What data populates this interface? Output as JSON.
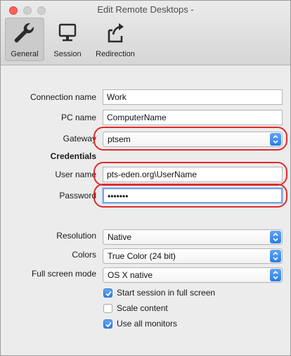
{
  "window": {
    "title": "Edit Remote Desktops -"
  },
  "toolbar": {
    "general_label": "General",
    "session_label": "Session",
    "redirection_label": "Redirection"
  },
  "form": {
    "connection_name": {
      "label": "Connection name",
      "value": "Work"
    },
    "pc_name": {
      "label": "PC name",
      "value": "ComputerName"
    },
    "gateway": {
      "label": "Gateway",
      "value": "ptsem"
    },
    "credentials_heading": "Credentials",
    "user_name": {
      "label": "User name",
      "value": "pts-eden.org\\UserName"
    },
    "password": {
      "label": "Password",
      "value": "•••••••"
    },
    "resolution": {
      "label": "Resolution",
      "value": "Native"
    },
    "colors": {
      "label": "Colors",
      "value": "True Color (24 bit)"
    },
    "full_screen_mode": {
      "label": "Full screen mode",
      "value": "OS X native"
    },
    "checkboxes": [
      {
        "label": "Start session in full screen",
        "checked": true
      },
      {
        "label": "Scale content",
        "checked": false
      },
      {
        "label": "Use all monitors",
        "checked": true
      }
    ]
  },
  "colors": {
    "accent": "#2b7de9",
    "highlight": "#e12a2a",
    "close_button": "#fc605c"
  },
  "icons": {
    "general": "wrench-icon",
    "session": "monitor-icon",
    "redirection": "export-icon",
    "dropdown": "updown-arrows-icon"
  }
}
